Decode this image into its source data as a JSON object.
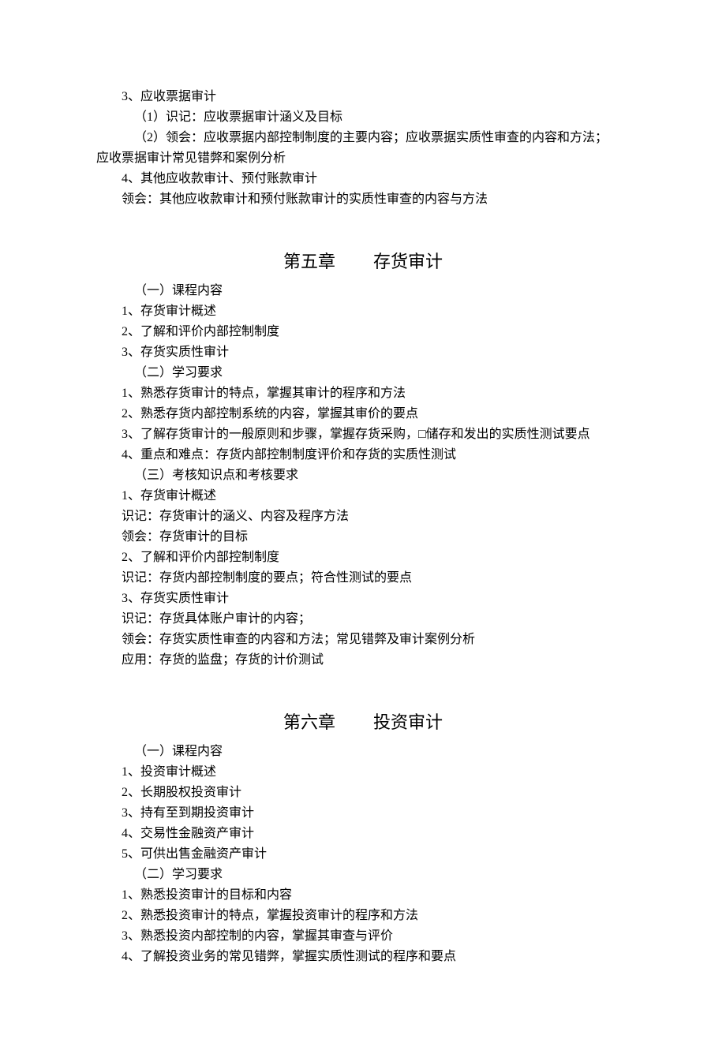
{
  "intro": {
    "l1": "3、应收票据审计",
    "l2": "（1）识记：应收票据审计涵义及目标",
    "l3": "（2）领会：应收票据内部控制制度的主要内容；应收票据实质性审查的内容和方法；",
    "l4": "应收票据审计常见错弊和案例分析",
    "l5": "4、其他应收款审计、预付账款审计",
    "l6": "领会：其他应收款审计和预付账款审计的实质性审查的内容与方法"
  },
  "ch5": {
    "chapter": "第五章",
    "title": "存货审计",
    "s1": "（一）课程内容",
    "a1": "1、存货审计概述",
    "a2": "2、了解和评价内部控制制度",
    "a3": "3、存货实质性审计",
    "s2": "（二）学习要求",
    "b1": "1、熟悉存货审计的特点，掌握其审计的程序和方法",
    "b2": "2、熟悉存货内部控制系统的内容，掌握其审价的要点",
    "b3": "3、了解存货审计的一般原则和步骤，掌握存货采购，□储存和发出的实质性测试要点",
    "b4": "4、重点和难点：存货内部控制制度评价和存货的实质性测试",
    "s3": "（三）考核知识点和考核要求",
    "c1": "1、存货审计概述",
    "c2": "识记：存货审计的涵义、内容及程序方法",
    "c3": "领会：存货审计的目标",
    "c4": "2、了解和评价内部控制制度",
    "c5": "识记：存货内部控制制度的要点；符合性测试的要点",
    "c6": "3、存货实质性审计",
    "c7": "识记：存货具体账户审计的内容；",
    "c8": "领会：存货实质性审查的内容和方法；常见错弊及审计案例分析",
    "c9": "应用：存货的监盘；存货的计价测试"
  },
  "ch6": {
    "chapter": "第六章",
    "title": "投资审计",
    "s1": "（一）课程内容",
    "a1": "1、投资审计概述",
    "a2": "2、长期股权投资审计",
    "a3": "3、持有至到期投资审计",
    "a4": "4、交易性金融资产审计",
    "a5": "5、可供出售金融资产审计",
    "s2": "（二）学习要求",
    "b1": "1、熟悉投资审计的目标和内容",
    "b2": "2、熟悉投资审计的特点，掌握投资审计的程序和方法",
    "b3": "3、熟悉投资内部控制的内容，掌握其审查与评价",
    "b4": "4、了解投资业务的常见错弊，掌握实质性测试的程序和要点"
  }
}
